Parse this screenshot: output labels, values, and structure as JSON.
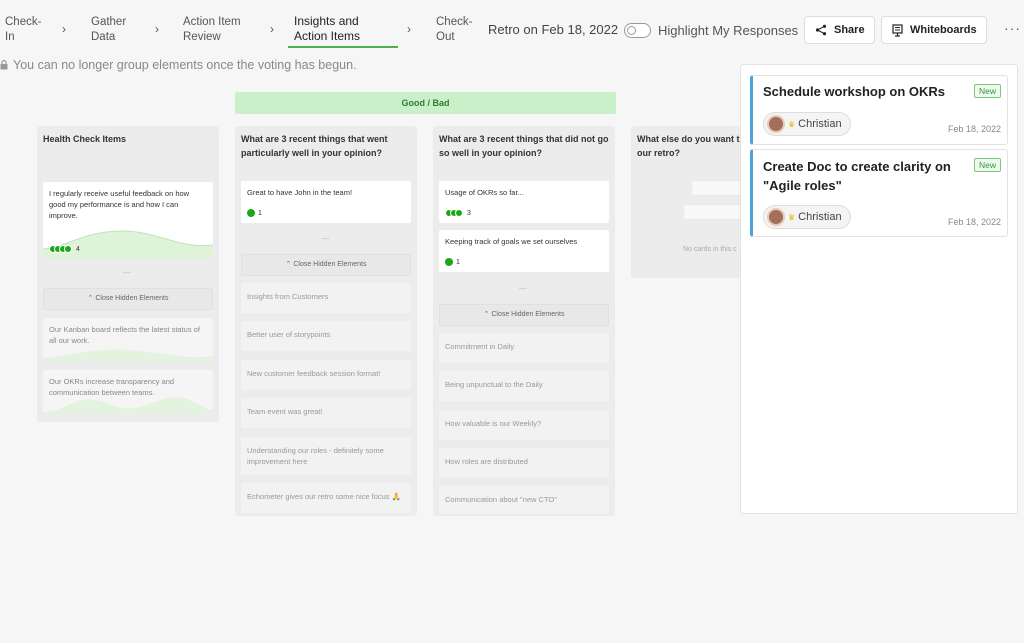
{
  "steps": [
    {
      "label": "Check-In",
      "l1": "Check-",
      "l2": "In"
    },
    {
      "label": "Gather Data",
      "l1": "Gather",
      "l2": "Data"
    },
    {
      "label": "Action Item Review",
      "l1": "Action Item",
      "l2": "Review"
    },
    {
      "label": "Insights and Action Items",
      "l1": "Insights and",
      "l2": "Action Items"
    },
    {
      "label": "Check-Out",
      "l1": "Check-",
      "l2": "Out"
    }
  ],
  "retro_title": "Retro on Feb 18, 2022",
  "highlight_label": "Highlight My Responses",
  "buttons": {
    "share": "Share",
    "whiteboards": "Whiteboards",
    "more": "···"
  },
  "notice": "You can no longer group elements once the voting has begun.",
  "section_title": "Good / Bad",
  "close_hidden": "Close Hidden Elements",
  "columns": [
    {
      "title": "Health Check Items",
      "cards": [
        {
          "text": "I regularly receive useful feedback on how good my performance is and how I can improve.",
          "votes": "4"
        }
      ],
      "hidden": [
        "Our Kanban board reflects the latest status of all our work.",
        "Our OKRs increase transparency and communication between teams."
      ]
    },
    {
      "title": "What are 3 recent things that went particularly well in your opinion?",
      "cards": [
        {
          "text": "Great to have John in the team!",
          "votes": "1"
        }
      ],
      "hidden": [
        "Insights from Customers",
        "Better user of storypoints",
        "New customer feedback session format!",
        "Team event was great!",
        "Understanding our roles - definitely some improvement here",
        "Echometer gives our retro some nice focus 🙏"
      ]
    },
    {
      "title": "What are 3 recent things that did not go so well in your opinion?",
      "cards": [
        {
          "text": "Usage of OKRs so far...",
          "votes": "3"
        },
        {
          "text": "Keeping track of goals we set ourselves",
          "votes": "1"
        }
      ],
      "hidden": [
        "Commitment in Daily",
        "Being unpunctual to the Daily",
        "How valuable is our Weekly?",
        "How roles are distributed",
        "Communication about \"new CTO\""
      ]
    },
    {
      "title": "What else do you want t... our retro?",
      "title_l1": "What else do you want t",
      "title_l2": "our retro?",
      "empty_text": "No cards in this c"
    }
  ],
  "action_items": [
    {
      "title": "Schedule workshop on OKRs",
      "badge": "New",
      "user": "Christian",
      "date": "Feb 18, 2022"
    },
    {
      "title": "Create Doc to create clarity on \"Agile roles\"",
      "title_l1": "Create Doc to create clarity on",
      "title_l2": "\"Agile roles\"",
      "badge": "New",
      "user": "Christian",
      "date": "Feb 18, 2022"
    }
  ],
  "colors": {
    "accent_green": "#4caf50",
    "vote_green": "#1aa81a",
    "section_bg": "#c9f0c9",
    "action_border": "#4aa3df"
  }
}
